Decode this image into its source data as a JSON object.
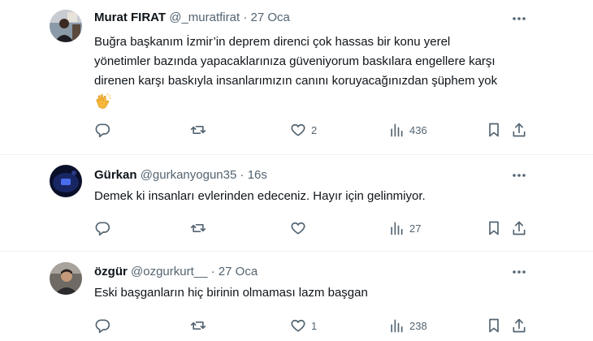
{
  "tweets": [
    {
      "name": "Murat FIRAT",
      "handle": "@_muratfirat",
      "dot": "·",
      "time": "27 Oca",
      "lines": [
        "Buğra başkanım İzmir’in deprem direnci çok hassas bir konu yerel",
        "yönetimler bazında yapacaklarınıza güveniyorum baskılara engellere karşı",
        "direnen karşı baskıyla insanlarımızın canını koruyacağınızdan şüphem yok"
      ],
      "emoji": "👏",
      "likes": "2",
      "views": "436"
    },
    {
      "name": "Gürkan",
      "handle": "@gurkanyogun35",
      "dot": "·",
      "time": "16s",
      "lines": [
        "Demek ki insanları evlerinden edeceniz. Hayır için gelinmiyor."
      ],
      "likes": "",
      "views": "27"
    },
    {
      "name": "özgür",
      "handle": "@ozgurkurt__",
      "dot": "·",
      "time": "27 Oca",
      "lines": [
        "Eski başganların hiç birinin olmaması lazm başgan"
      ],
      "likes": "1",
      "views": "238"
    }
  ],
  "icons": {
    "reply": "reply-icon",
    "retweet": "retweet-icon",
    "like": "heart-icon",
    "views": "views-icon",
    "bookmark": "bookmark-icon",
    "share": "share-icon",
    "more": "more-icon"
  },
  "colors": {
    "text": "#0f1419",
    "secondary": "#536471",
    "separator": "#eff3f4"
  }
}
